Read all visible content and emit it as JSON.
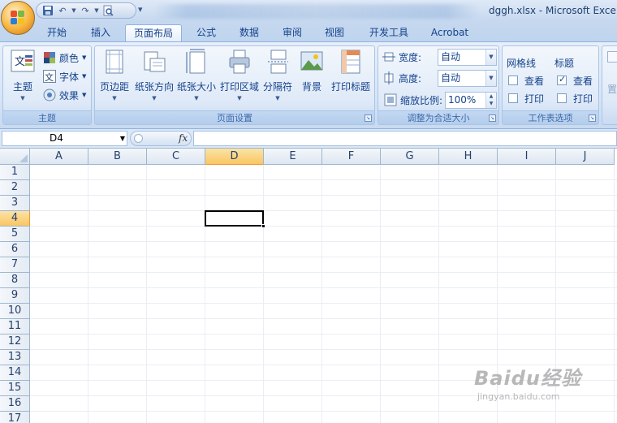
{
  "window": {
    "title": "dggh.xlsx - Microsoft Exce"
  },
  "tabs": [
    {
      "label": "开始",
      "active": false
    },
    {
      "label": "插入",
      "active": false
    },
    {
      "label": "页面布局",
      "active": true
    },
    {
      "label": "公式",
      "active": false
    },
    {
      "label": "数据",
      "active": false
    },
    {
      "label": "审阅",
      "active": false
    },
    {
      "label": "视图",
      "active": false
    },
    {
      "label": "开发工具",
      "active": false
    },
    {
      "label": "Acrobat",
      "active": false
    }
  ],
  "ribbon": {
    "themes": {
      "group_label": "主题",
      "theme_button": "主题",
      "colors": "颜色",
      "fonts": "字体",
      "effects": "效果"
    },
    "page_setup": {
      "group_label": "页面设置",
      "margins": "页边距",
      "orientation": "纸张方向",
      "size": "纸张大小",
      "print_area": "打印区域",
      "breaks": "分隔符",
      "background": "背景",
      "print_titles": "打印标题"
    },
    "scale_to_fit": {
      "group_label": "调整为合适大小",
      "width_label": "宽度:",
      "width_value": "自动",
      "height_label": "高度:",
      "height_value": "自动",
      "scale_label": "缩放比例:",
      "scale_value": "100%"
    },
    "sheet_options": {
      "group_label": "工作表选项",
      "gridlines_title": "网格线",
      "gridlines_view": "查看",
      "gridlines_view_checked": false,
      "gridlines_print": "打印",
      "gridlines_print_checked": false,
      "headings_title": "标题",
      "headings_view": "查看",
      "headings_view_checked": true,
      "headings_print": "打印",
      "headings_print_checked": false
    },
    "arrange": {
      "partial_label": "置"
    }
  },
  "formula_bar": {
    "name_box": "D4",
    "fx": "fx",
    "formula": ""
  },
  "grid": {
    "columns": [
      "A",
      "B",
      "C",
      "D",
      "E",
      "F",
      "G",
      "H",
      "I",
      "J"
    ],
    "rows": [
      "1",
      "2",
      "3",
      "4",
      "5",
      "6",
      "7",
      "8",
      "9",
      "10",
      "11",
      "12",
      "13",
      "14",
      "15",
      "16",
      "17"
    ],
    "selected_column": "D",
    "selected_row": "4"
  },
  "watermark": {
    "main": "Baidu经验",
    "sub": "jingyan.baidu.com"
  },
  "colors": {
    "ribbon_text": "#15428b",
    "selected_header": "#f9c664"
  }
}
